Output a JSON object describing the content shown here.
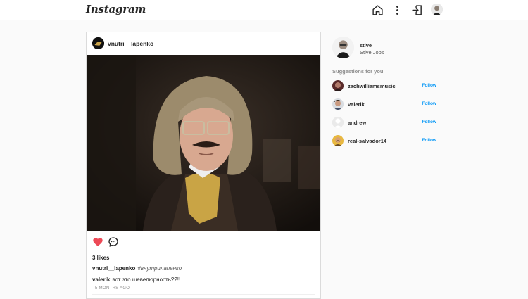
{
  "header": {
    "logo": "Instagram",
    "icons": [
      "home-icon",
      "more-vertical-icon",
      "logout-icon",
      "profile-avatar"
    ]
  },
  "post": {
    "username": "vnutri__lapenko",
    "likes": "3 likes",
    "caption_user": "vnutri__lapenko",
    "caption_text": "#внутрилапенко",
    "comment_user": "valerik",
    "comment_text": "вот это шевелюрность??!!",
    "time": "5 MONTHS AGO",
    "liked": true
  },
  "sidebar": {
    "username": "stive",
    "fullname": "Stive Jobs",
    "suggestions_title": "Suggestions for you",
    "follow_label": "Follow",
    "suggestions": [
      {
        "username": "zachwilliamsmusic",
        "follow": "Follow"
      },
      {
        "username": "valerik",
        "follow": "Follow"
      },
      {
        "username": "andrew",
        "follow": "Follow"
      },
      {
        "username": "real-salvador14",
        "follow": "Follow"
      }
    ]
  },
  "colors": {
    "accent": "#0095f6",
    "heart": "#ed4956",
    "border": "#dbdbdb",
    "background": "#fafafa"
  }
}
